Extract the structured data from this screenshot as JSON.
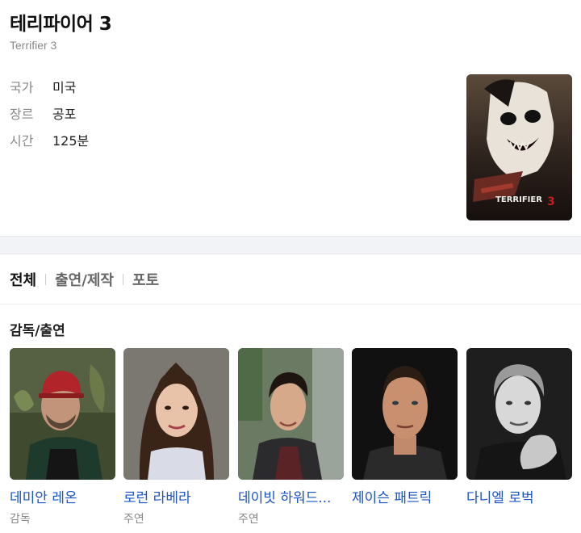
{
  "movie": {
    "title": "테리파이어 3",
    "original_title": "Terrifier 3",
    "info": [
      {
        "label": "국가",
        "value": "미국"
      },
      {
        "label": "장르",
        "value": "공포"
      },
      {
        "label": "시간",
        "value": "125분"
      }
    ],
    "poster": {
      "caption": "TERRIFIER 3",
      "icon": "movie-poster"
    }
  },
  "tabs": [
    {
      "label": "전체",
      "active": true
    },
    {
      "label": "출연/제작",
      "active": false
    },
    {
      "label": "포토",
      "active": false
    }
  ],
  "section": {
    "title": "감독/출연"
  },
  "cast": [
    {
      "name": "데미안 레온",
      "role": "감독"
    },
    {
      "name": "로런 라베라",
      "role": "주연"
    },
    {
      "name": "데이빗 하워드...",
      "role": "주연"
    },
    {
      "name": "제이슨 패트릭",
      "role": ""
    },
    {
      "name": "다니엘 로벅",
      "role": ""
    }
  ],
  "colors": {
    "link": "#1a54c8",
    "muted": "#888888",
    "band": "#f1f3f6"
  }
}
